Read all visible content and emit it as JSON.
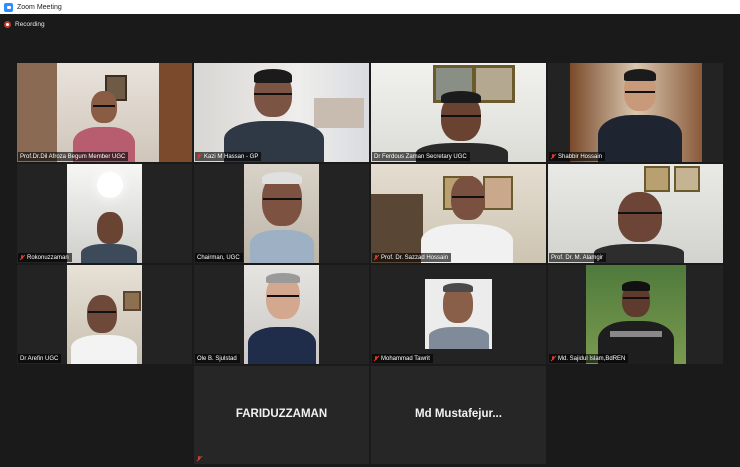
{
  "window": {
    "title": "Zoom Meeting"
  },
  "recording": {
    "label": "Recording"
  },
  "participants": [
    {
      "name": "Prof.Dr.Dil Afroza Begum Member UGC",
      "muted": false
    },
    {
      "name": "Kazi M Hassan - GP",
      "muted": true
    },
    {
      "name": "Dr Ferdous Zaman Secretary UGC",
      "muted": false,
      "speaking": true
    },
    {
      "name": "Shabbir Hossain",
      "muted": true
    },
    {
      "name": "Rokonuzzaman",
      "muted": true
    },
    {
      "name": "Chairman, UGC",
      "muted": false
    },
    {
      "name": "Prof. Dr. Sazzad Hossain",
      "muted": true
    },
    {
      "name": "Prof. Dr. M. Alamgir",
      "muted": false
    },
    {
      "name": "Dr Arefin UGC",
      "muted": false
    },
    {
      "name": "Ole B. Sjulstad",
      "muted": false
    },
    {
      "name": "Mohammad Tawrit",
      "muted": true
    },
    {
      "name": "Md. Sajidul Islam,BdREN",
      "muted": true
    },
    {
      "name": "FARIDUZZAMAN",
      "muted": true,
      "video_off": true
    },
    {
      "name": "Md Mustafejur...",
      "muted": false,
      "video_off": true
    }
  ],
  "colors": {
    "speaking_border": "#b8d430",
    "muted_icon": "#e0372b",
    "background": "#1a1a1a",
    "tile": "#232323"
  }
}
